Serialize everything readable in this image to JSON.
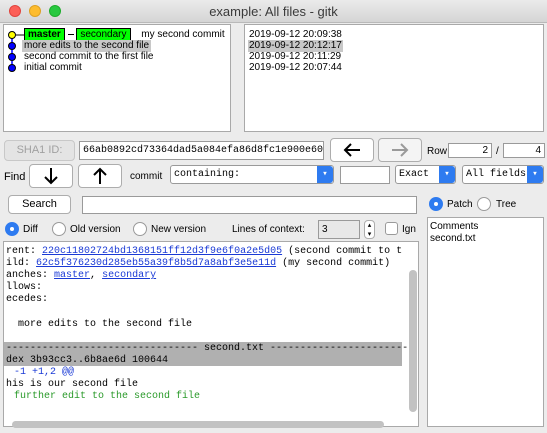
{
  "window": {
    "title": "example: All files - gitk"
  },
  "commits": {
    "branch_tags": [
      "master",
      "secondary"
    ],
    "items": [
      {
        "message": "my second commit",
        "date": "2019-09-12 20:09:38"
      },
      {
        "message": "more edits to the second file",
        "date": "2019-09-12 20:12:17"
      },
      {
        "message": "second commit to the first file",
        "date": "2019-09-12 20:11:29"
      },
      {
        "message": "initial commit",
        "date": "2019-09-12 20:07:44"
      }
    ],
    "colors": {
      "branch_tag": "#00ff00",
      "graph": "#0000ff",
      "selected": "#c8c8c8"
    }
  },
  "sha": {
    "label": "SHA1 ID:",
    "value": "66ab0892cd73364dad5a084efa86d8fc1e900e60",
    "back_icon": "left-arrow-icon",
    "forward_icon": "right-arrow-icon",
    "row_label": "Row",
    "row_current": "2",
    "row_sep": "/",
    "row_total": "4"
  },
  "find": {
    "label": "Find",
    "down_icon": "down-arrow-icon",
    "up_icon": "up-arrow-icon",
    "type_label": "commit",
    "mode": "containing:",
    "value": "",
    "match": "Exact",
    "fields": "All fields"
  },
  "search": {
    "button": "Search",
    "value": ""
  },
  "options": {
    "diff": "Diff",
    "old_version": "Old version",
    "new_version": "New version",
    "context_label": "Lines of context:",
    "context_value": "3",
    "ignore": "Ign",
    "patch": "Patch",
    "tree": "Tree"
  },
  "details": {
    "parent_label": "rent:",
    "parent_sha": "220c11802724bd1368151ff12d3f9e6f0a2e5d05",
    "parent_msg": "(second commit to t",
    "child_label": "ild:",
    "child_sha": "62c5f376230d285eb55a39f8b5d7a8abf3e5e11d",
    "child_msg": "(my second commit)",
    "branches_label": "anches:",
    "branch_master": "master",
    "branch_sep": ",",
    "branch_secondary": "secondary",
    "follows_label": "llows:",
    "precedes_label": "ecedes:",
    "commit_message": "more edits to the second file",
    "file_header": "-------------------------------- second.txt ------------------------",
    "index_line": "dex 3b93cc3..6b8ae6d 100644",
    "hunk": "-1 +1,2 @@",
    "context_line": "his is our second file",
    "added_line": "further edit to the second file"
  },
  "files": {
    "items": [
      "Comments",
      "second.txt"
    ]
  }
}
